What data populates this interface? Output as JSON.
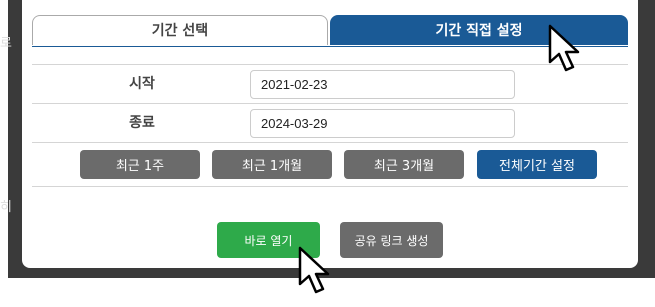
{
  "background": {
    "fragment_top": "로",
    "fragment_bottom": "히"
  },
  "modal": {
    "tabs": [
      {
        "label": "기간 선택",
        "active": false
      },
      {
        "label": "기간 직접 설정",
        "active": true
      }
    ],
    "start": {
      "label": "시작",
      "value": "2021-02-23"
    },
    "end": {
      "label": "종료",
      "value": "2024-03-29"
    },
    "quick_buttons": [
      {
        "label": "최근 1주"
      },
      {
        "label": "최근 1개월"
      },
      {
        "label": "최근 3개월"
      },
      {
        "label": "전체기간 설정"
      }
    ],
    "open_button": "바로 열기",
    "share_button": "공유 링크 생성"
  },
  "colors": {
    "accent_blue": "#1a5a96",
    "gray_button": "#6b6b6b",
    "green_button": "#2eaa4a"
  },
  "icons": [
    "arrow-cursor-icon"
  ]
}
